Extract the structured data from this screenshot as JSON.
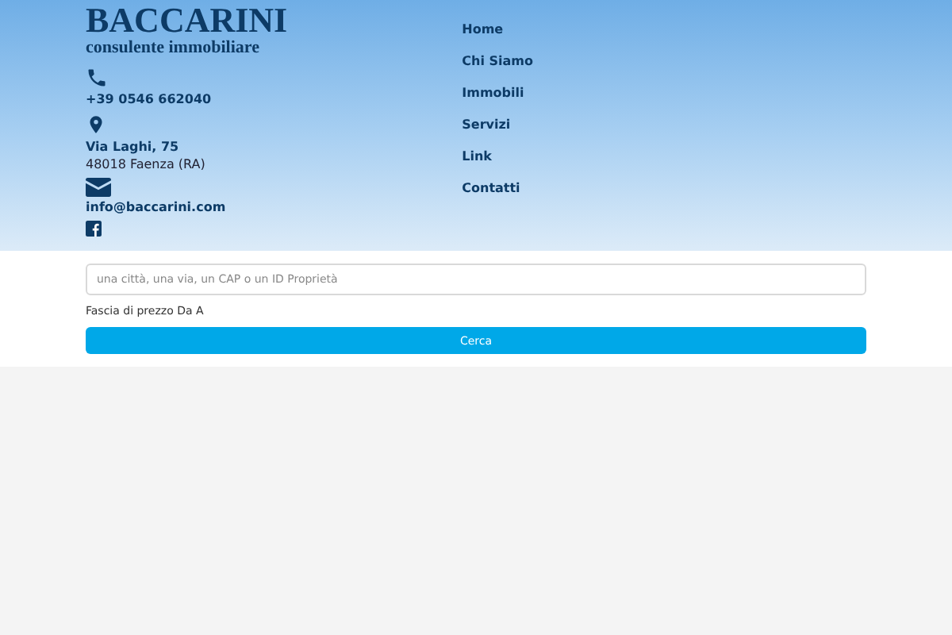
{
  "logo": {
    "name": "BACCARINI",
    "tagline": "consulente immobiliare"
  },
  "contacts": [
    {
      "kind": "phone",
      "lines": [
        "+39 0546 662040"
      ]
    },
    {
      "kind": "address",
      "lines": [
        "Via Laghi, 75",
        "48018 Faenza (RA)"
      ]
    },
    {
      "kind": "email",
      "lines": [
        "info@baccarini.com"
      ]
    },
    {
      "kind": "facebook"
    }
  ],
  "nav": [
    "Home",
    "Chi Siamo",
    "Immobili",
    "Servizi",
    "Link",
    "Contatti"
  ],
  "search": {
    "placeholder": "una città, una via, un CAP o un ID Proprietà",
    "price_label": "Fascia di prezzo Da A",
    "button": "Cerca"
  }
}
